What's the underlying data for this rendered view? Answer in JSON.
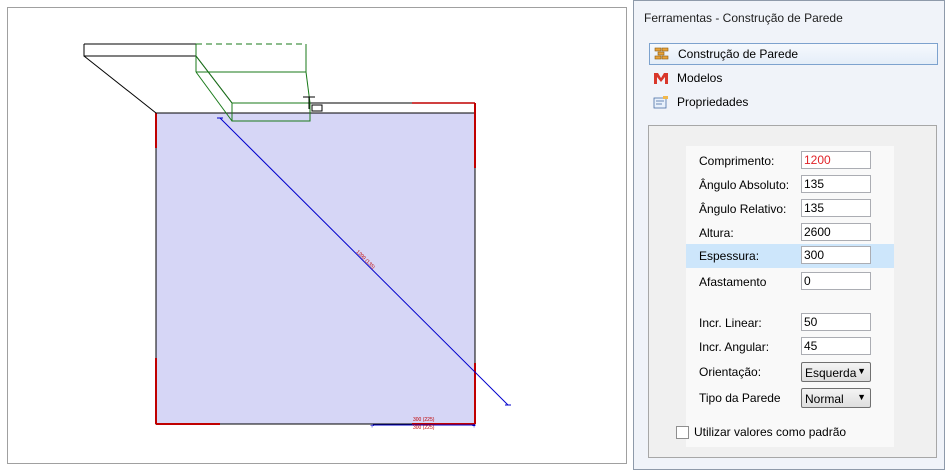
{
  "canvas": {
    "dimension_label_diagonal": "1200 (135)",
    "dimension_label_bottom_1": "300 (225)",
    "dimension_label_bottom_2": "300 (225)"
  },
  "panel": {
    "title": "Ferramentas - Construção de Parede",
    "nav": [
      {
        "label": "Construção de Parede",
        "icon": "wall-construction-icon",
        "active": true
      },
      {
        "label": "Modelos",
        "icon": "models-icon",
        "active": false
      },
      {
        "label": "Propriedades",
        "icon": "properties-icon",
        "active": false
      }
    ],
    "fields": {
      "comprimento": {
        "label": "Comprimento:",
        "value": "1200"
      },
      "angulo_absoluto": {
        "label": "Ângulo Absoluto:",
        "value": "135"
      },
      "angulo_relativo": {
        "label": "Ângulo Relativo:",
        "value": "135"
      },
      "altura": {
        "label": "Altura:",
        "value": "2600"
      },
      "espessura": {
        "label": "Espessura:",
        "value": "300"
      },
      "afastamento": {
        "label": "Afastamento",
        "value": "0"
      },
      "incr_linear": {
        "label": "Incr. Linear:",
        "value": "50"
      },
      "incr_angular": {
        "label": "Incr. Angular:",
        "value": "45"
      },
      "orientacao": {
        "label": "Orientação:",
        "value": "Esquerda"
      },
      "tipo_parede": {
        "label": "Tipo da Parede",
        "value": "Normal"
      }
    },
    "default_checkbox_label": "Utilizar valores como padrão"
  },
  "colors": {
    "room_fill": "#d8d8f8",
    "wall_red": "#c00000",
    "dimension_blue": "#0000cc",
    "wall_green": "#1a7a1a"
  }
}
